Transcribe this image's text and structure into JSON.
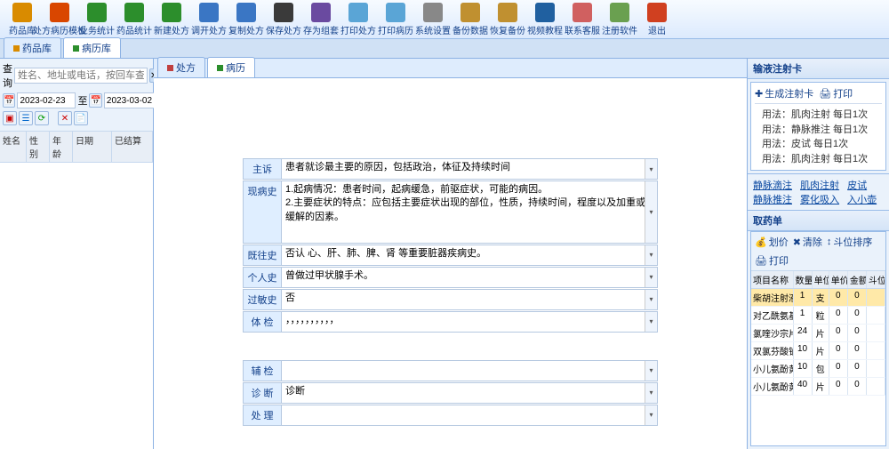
{
  "toolbar": [
    {
      "label": "药品库",
      "color": "#d98b00"
    },
    {
      "label": "处方病历模板",
      "color": "#d94600"
    },
    {
      "label": "业务统计",
      "color": "#2c8e2c"
    },
    {
      "label": "药品统计",
      "color": "#2c8e2c"
    },
    {
      "label": "新建处方",
      "color": "#2c8e2c"
    },
    {
      "label": "调开处方",
      "color": "#3a76c4"
    },
    {
      "label": "复制处方",
      "color": "#3a76c4"
    },
    {
      "label": "保存处方",
      "color": "#3a3a3a"
    },
    {
      "label": "存为组套",
      "color": "#6a4aa0"
    },
    {
      "label": "打印处方",
      "color": "#5aa5d6"
    },
    {
      "label": "打印病历",
      "color": "#5aa5d6"
    },
    {
      "label": "系统设置",
      "color": "#888"
    },
    {
      "label": "备份数据",
      "color": "#c09030"
    },
    {
      "label": "恢复备份",
      "color": "#c09030"
    },
    {
      "label": "视频教程",
      "color": "#2060a0"
    },
    {
      "label": "联系客服",
      "color": "#d06060"
    },
    {
      "label": "注册软件",
      "color": "#6aa050"
    },
    {
      "label": "退出",
      "color": "#d04020"
    }
  ],
  "topTabs": {
    "drug": "药品库",
    "history": "病历库"
  },
  "left": {
    "searchLabel": "查询",
    "searchPlaceholder": "姓名、地址或电话，按回车查询",
    "dateFrom": "2023-02-23",
    "to": "至",
    "dateTo": "2023-03-02",
    "cols": {
      "name": "姓名",
      "sex": "性别",
      "age": "年龄",
      "date": "日期",
      "settle": "已结算"
    }
  },
  "centerTabs": {
    "rx": "处方",
    "rec": "病历"
  },
  "form": {
    "chief": {
      "label": "主诉",
      "value": "患者就诊最主要的原因，包括政治，体征及持续时间"
    },
    "present": {
      "label": "现病史",
      "value": "1.起病情况：患者时间，起病缓急，前驱症状，可能的病因。\n2.主要症状的特点：应包括主要症状出现的部位，性质，持续时间，程度以及加重或缓解的因素。"
    },
    "past": {
      "label": "既往史",
      "value": "否认 心、肝、肺、脾、肾 等重要脏器疾病史。"
    },
    "personal": {
      "label": "个人史",
      "value": "曾做过甲状腺手术。"
    },
    "allergy": {
      "label": "过敏史",
      "value": "否"
    },
    "exam": {
      "label": "体 检",
      "value": "，，，，，，，，，，"
    },
    "aux": {
      "label": "辅 检",
      "value": ""
    },
    "diag": {
      "label": "诊 断",
      "value": "诊断"
    },
    "treat": {
      "label": "处 理",
      "value": ""
    }
  },
  "right": {
    "cardTitle": "输液注射卡",
    "genCard": "生成注射卡",
    "print": "打印",
    "usages": [
      "用法：肌肉注射    每日1次",
      "用法：静脉推注    每日1次",
      "用法：皮试  每日1次",
      "用法：肌肉注射    每日1次"
    ],
    "methods": [
      "静脉滴注",
      "肌肉注射",
      "皮试",
      "静脉推注",
      "雾化吸入",
      "入小壶"
    ],
    "rxTitle": "取药单",
    "rxBtns": {
      "price": "划价",
      "clear": "清除",
      "sort": "斗位排序",
      "print": "打印"
    },
    "rxCols": {
      "name": "项目名称",
      "qty": "数量",
      "unit": "单位",
      "price": "单价",
      "amt": "金额",
      "pos": "斗位"
    },
    "rxRows": [
      {
        "name": "柴胡注射液",
        "qty": "1",
        "unit": "支",
        "price": "0",
        "amt": "0",
        "sel": true
      },
      {
        "name": "对乙酰氨基...",
        "qty": "1",
        "unit": "粒",
        "price": "0",
        "amt": "0"
      },
      {
        "name": "氯喹沙宗片",
        "qty": "24",
        "unit": "片",
        "price": "0",
        "amt": "0"
      },
      {
        "name": "双氯芬酸钠...",
        "qty": "10",
        "unit": "片",
        "price": "0",
        "amt": "0"
      },
      {
        "name": "小儿氨酚黄...",
        "qty": "10",
        "unit": "包",
        "price": "0",
        "amt": "0"
      },
      {
        "name": "小儿氨酚黄...",
        "qty": "40",
        "unit": "片",
        "price": "0",
        "amt": "0"
      }
    ]
  }
}
